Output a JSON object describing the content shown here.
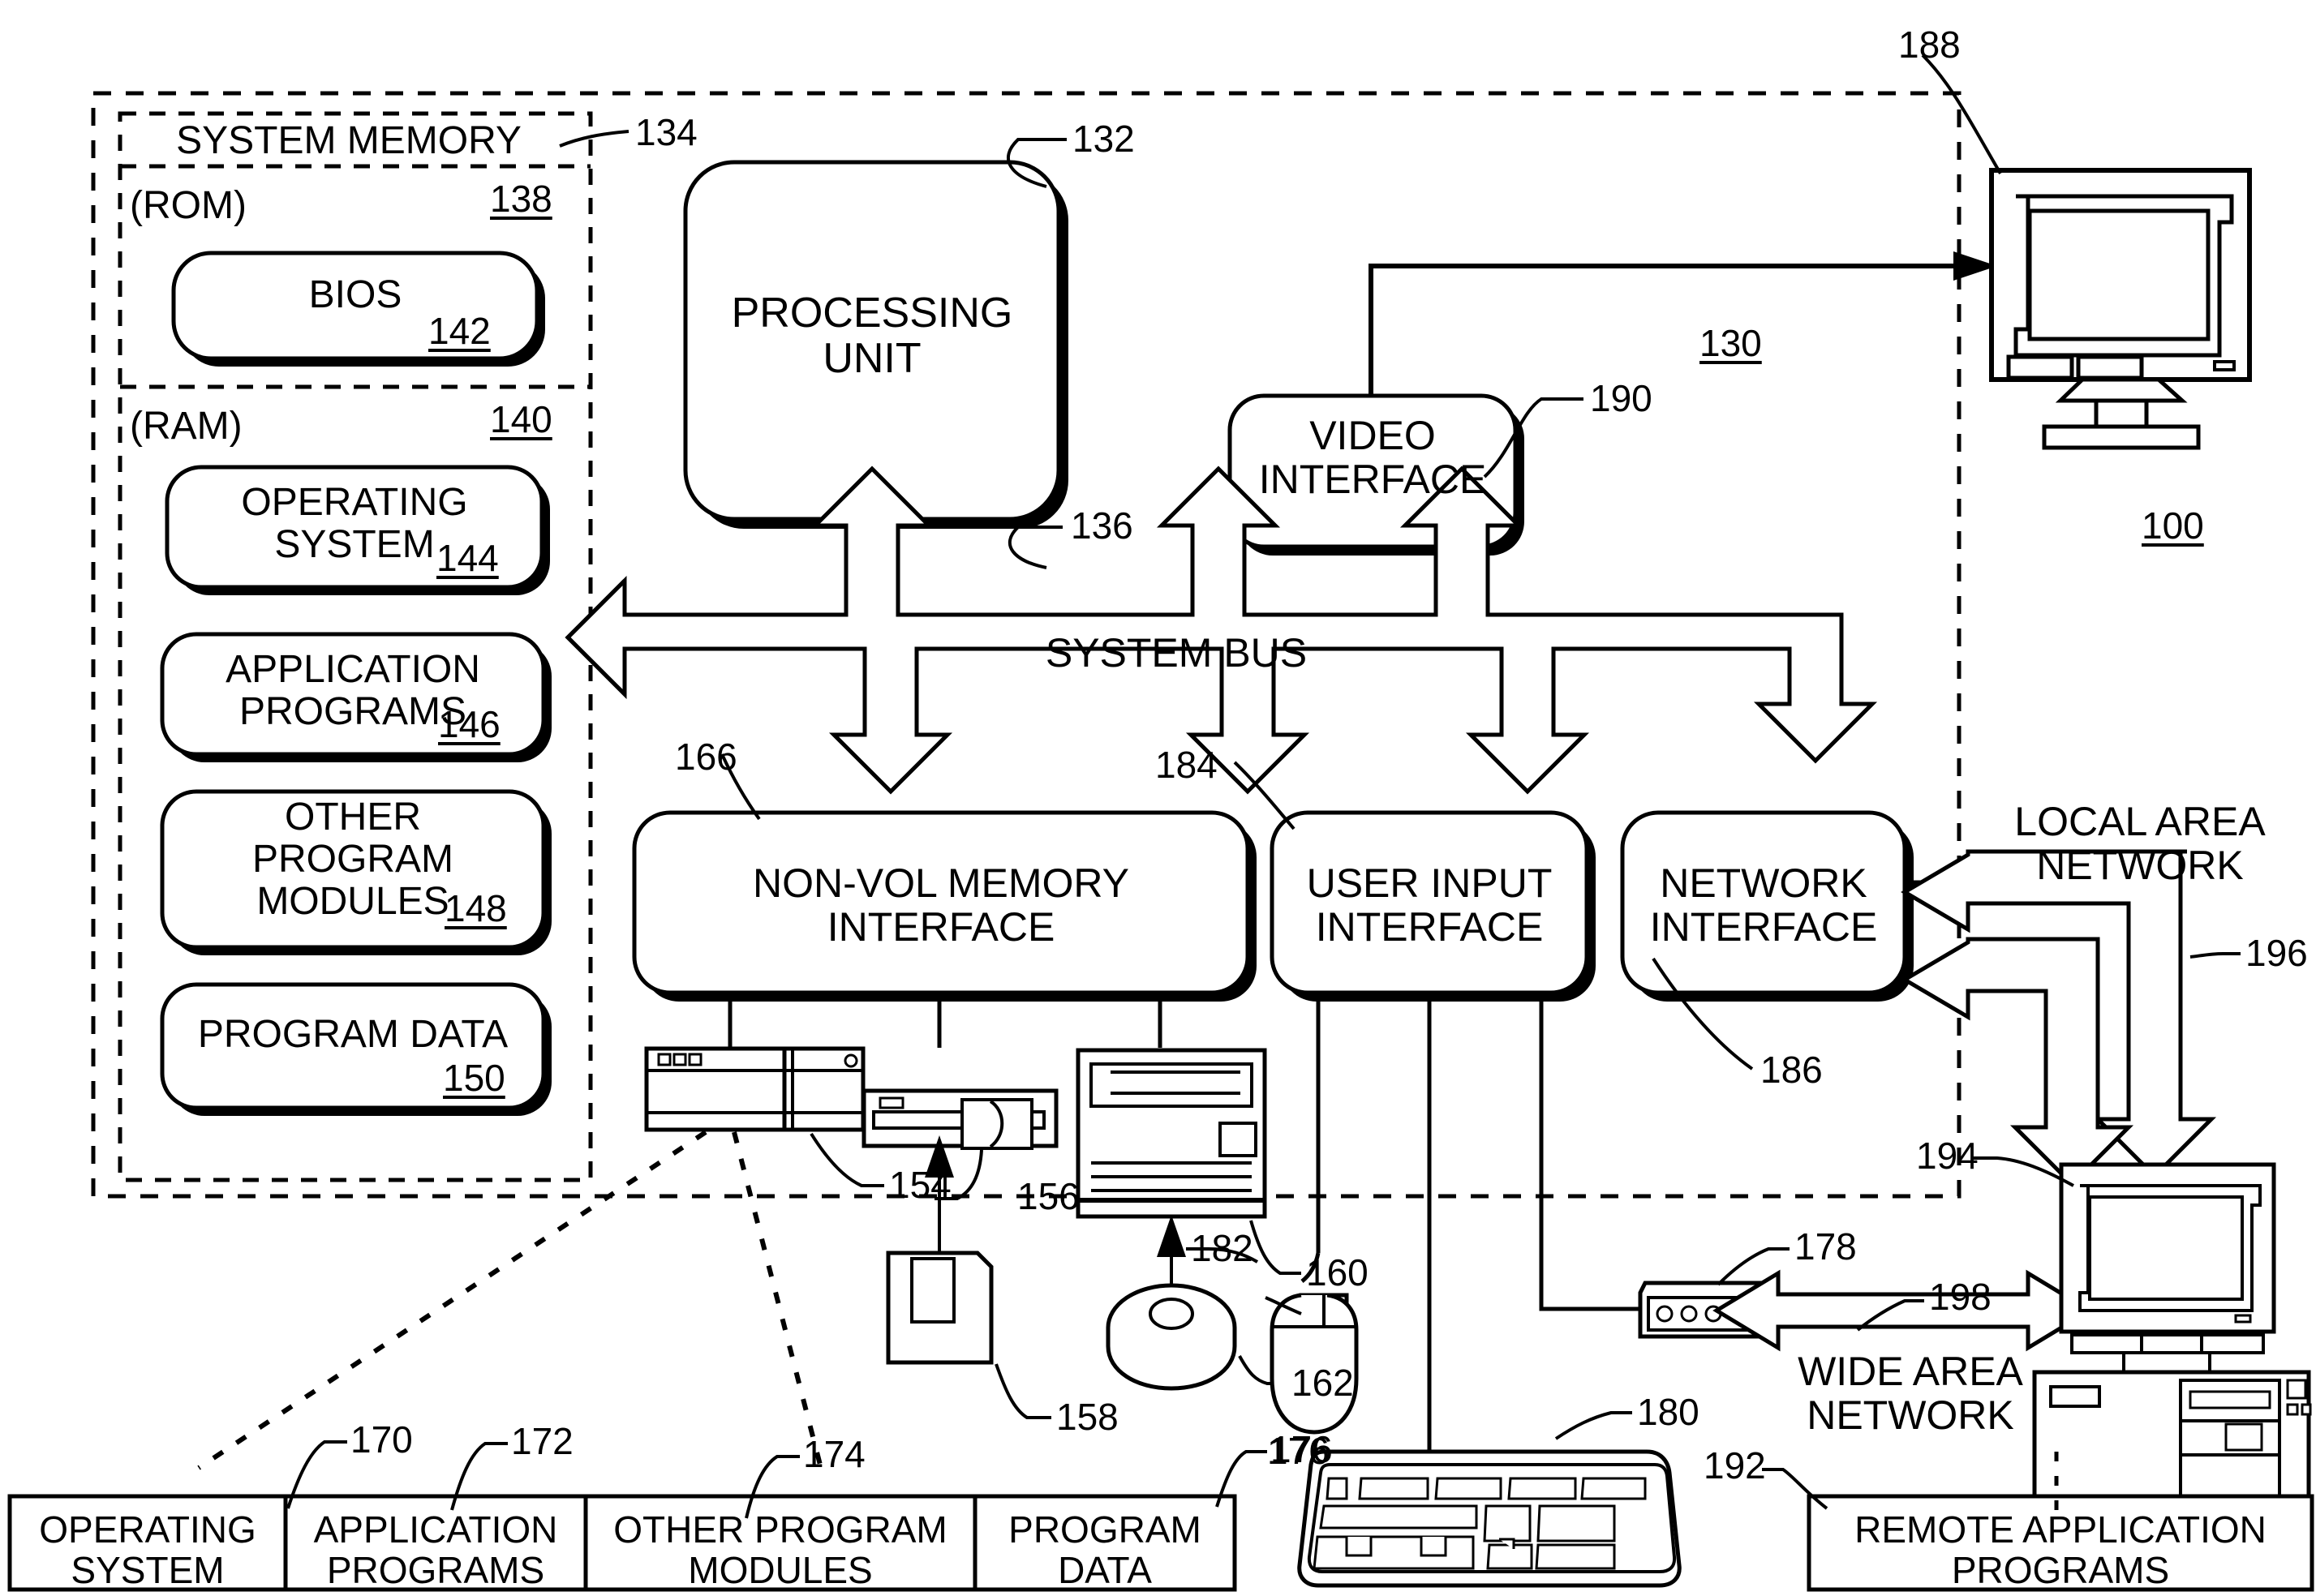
{
  "figure": {
    "title": "Computer system architecture block diagram",
    "figure_ref": "100",
    "computer_ref": "130"
  },
  "memory": {
    "system_memory_label": "SYSTEM MEMORY",
    "system_memory_ref": "134",
    "rom_label": "(ROM)",
    "rom_ref": "138",
    "bios_label": "BIOS",
    "bios_ref": "142",
    "ram_label": "(RAM)",
    "ram_ref": "140",
    "blocks": [
      {
        "label": "OPERATING\nSYSTEM",
        "ref": "144"
      },
      {
        "label": "APPLICATION\nPROGRAMS",
        "ref": "146"
      },
      {
        "label": "OTHER\nPROGRAM\nMODULES",
        "ref": "148"
      },
      {
        "label": "PROGRAM DATA",
        "ref": "150"
      }
    ]
  },
  "processing_unit": {
    "label": "PROCESSING\nUNIT",
    "ref": "132"
  },
  "system_bus": {
    "label": "SYSTEM BUS",
    "ref": "136"
  },
  "interfaces": [
    {
      "label": "NON-VOL MEMORY\nINTERFACE",
      "ref": "166"
    },
    {
      "label": "USER INPUT\nINTERFACE",
      "ref": "184"
    },
    {
      "label": "NETWORK\nINTERFACE",
      "ref": "186"
    },
    {
      "label": "VIDEO\nINTERFACE",
      "ref": "190"
    }
  ],
  "devices": {
    "hard_drive_ref": "154",
    "floppy_drive_ref": "156",
    "floppy_disk_ref": "158",
    "optical_drive_ref": "160",
    "optical_disc_ref": "162",
    "mouse_ref": "176",
    "modem_ref": "178",
    "keyboard_ref": "180",
    "pointing_device_ref": "182",
    "monitor_ref": "188",
    "remote_computer_ref": "194"
  },
  "networks": {
    "lan_label": "LOCAL AREA\nNETWORK",
    "lan_ref": "196",
    "wan_label": "WIDE AREA\nNETWORK",
    "wan_ref": "198"
  },
  "storage_labels": [
    {
      "label": "OPERATING\nSYSTEM",
      "ref": "170"
    },
    {
      "label": "APPLICATION\nPROGRAMS",
      "ref": "172"
    },
    {
      "label": "OTHER PROGRAM\nMODULES",
      "ref": "174"
    },
    {
      "label": "PROGRAM\nDATA",
      "ref": "176"
    }
  ],
  "remote": {
    "label": "REMOTE APPLICATION\nPROGRAMS",
    "ref": "192"
  },
  "colors": {
    "ink": "#000000",
    "paper": "#ffffff"
  }
}
